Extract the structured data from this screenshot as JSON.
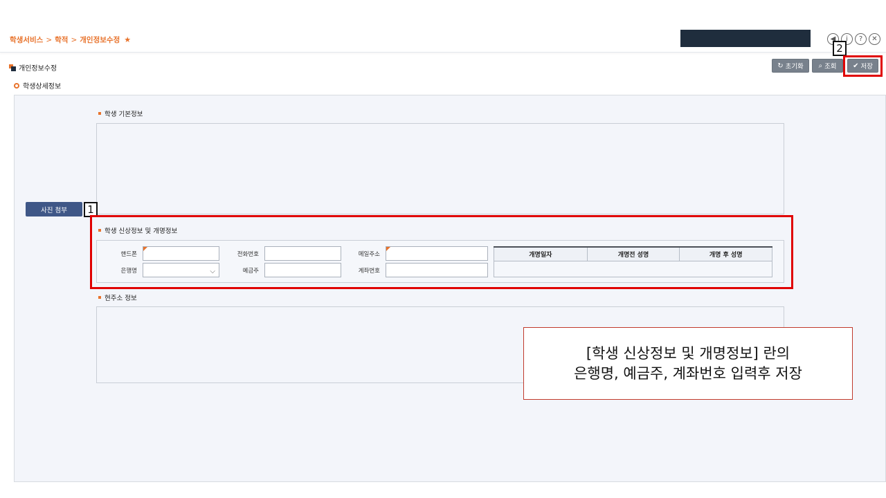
{
  "header": {
    "breadcrumb": [
      "학생서비스",
      "학적",
      "개인정보수정"
    ],
    "separator": ">",
    "favorite_icon": "star-icon",
    "window_icons": [
      "prev-icon",
      "info-icon",
      "help-icon",
      "close-icon"
    ],
    "window_icon_glyphs": [
      "◀",
      "i",
      "?",
      "✕"
    ]
  },
  "page": {
    "title": "개인정보수정",
    "subtitle": "학생상세정보"
  },
  "toolbar": {
    "reset_label": "초기화",
    "search_label": "조회",
    "save_label": "저장",
    "reset_icon": "↻",
    "search_icon": "⌕",
    "save_icon": "✔"
  },
  "sections": {
    "basic": "학생 기본정보",
    "personal": "학생 신상정보 및 개명정보",
    "address": "현주소 정보"
  },
  "photo_button": "사진 첨부",
  "form": {
    "phone_label": "핸드폰",
    "tel_label": "전화번호",
    "email_label": "메일주소",
    "bank_label": "은행명",
    "holder_label": "예금주",
    "account_label": "계좌번호",
    "phone_value": "",
    "tel_value": "",
    "email_value": "",
    "bank_value": "",
    "holder_value": "",
    "account_value": ""
  },
  "rename_table": {
    "headers": [
      "개명일자",
      "개명전 성명",
      "개명 후 성명"
    ],
    "rows": []
  },
  "annotations": {
    "marker_1": "1",
    "marker_2": "2",
    "note_line1": "[학생 신상정보 및 개명정보] 란의",
    "note_line2": "은행명, 예금주, 계좌번호 입력후 저장",
    "highlight_color": "#e00000"
  },
  "colors": {
    "accent": "#e8732c",
    "dark": "#1f2d3d",
    "button": "#78818c",
    "photo_button": "#3f5787"
  }
}
